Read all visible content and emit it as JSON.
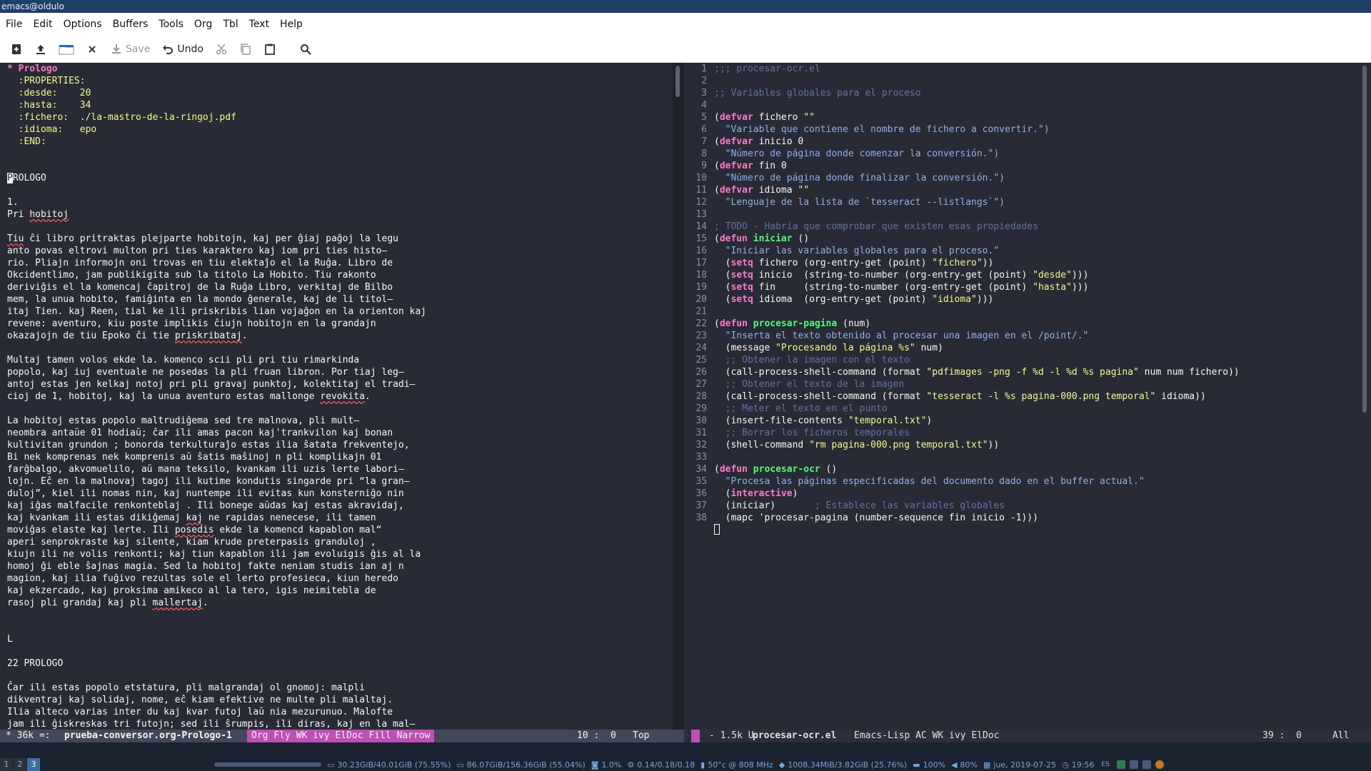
{
  "window": {
    "title": "emacs@oldulo"
  },
  "menubar": {
    "items": [
      "File",
      "Edit",
      "Options",
      "Buffers",
      "Tools",
      "Org",
      "Tbl",
      "Text",
      "Help"
    ]
  },
  "toolbar": {
    "save_label": "Save",
    "undo_label": "Undo",
    "icons": [
      "new-file-icon",
      "upload-icon",
      "open-folder-icon",
      "close-icon",
      "save-icon",
      "undo-icon",
      "cut-icon",
      "copy-icon",
      "paste-icon",
      "search-icon"
    ]
  },
  "left_buffer": {
    "lines": [
      "* Prologo",
      "  :PROPERTIES:",
      "  :desde:    20",
      "  :hasta:    34",
      "  :fichero:  ./la-mastro-de-la-ringoj.pdf",
      "  :idioma:   epo",
      "  :END:",
      "",
      "",
      "PROLOGO",
      "",
      "1.",
      "Pri hobitoj",
      "",
      "Tiu ĉi libro pritraktas plejparte hobitojn, kaj per ĝiaj paĝoj la legu",
      "anto povas eltrovi multon pri ties karaktero kaj iom pri ties histo—",
      "rio. Pliajn informojn oni trovas en tiu elektaĵo el la Ruĝa. Libro de",
      "Okcidentlimo, jam publikigita sub la titolo La Hobito. Tiu rakonto",
      "deriviĝis el la komencaj ĉapitroj de la Ruĝa Libro, verkitaj de Bilbo",
      "mem, la unua hobito, famiĝinta en la mondo ĝenerale, kaj de li titol—",
      "itaj Tien. kaj Reen, tial ke ili priskribis lian vojaĝon en la orienton kaj",
      "revene: aventuro, kiu poste implikis ĉiujn hobitojn en la grandajn",
      "okazajojn de tiu Epoko ĉi tie priskribataj.",
      "",
      "Multaj tamen volos ekde la. komenco scii pli pri tiu rimarkinda",
      "popolo, kaj iuj eventuale ne posedas la pli fruan libron. Por tiaj leg—",
      "antoj estas jen kelkaj notoj pri pli gravaj punktoj, kolektitaj el tradi—",
      "cioj de 1, hobitoj, kaj la unua aventuro estas mallonge revokita.",
      "",
      "La hobitoj estas popolo maltrudiĝema sed tre malnova, pli mult—",
      "neombra antaŭe 01 hodiaŭ; ĉar ili amas pacon kaj'trankvilon kaj bonan",
      "kultivitan grundon ; bonorda terkulturaĵo estas ilia ŝatata frekventejo,",
      "Bi nek komprenas nek komprenis aŭ ŝatis maŝinoj n pli komplikajn 01",
      "farĝbalgo, akvomuelilo, aŭ mana teksilo, kvankam ili uzis lerte labori—",
      "lojn. Eĉ en la malnovaj tagoj ili kutime kondutis singarde pri “la gran—",
      "duloj”, kiel ili nomas nin, kaj nuntempe ili evitas kun konsterniĝo nin",
      "kaj iĝas malfacile renkonteblaj . Ili bonege aŭdas kaj estas akravidaj,",
      "kaj kvankam ili estas dikiĝemaj kaj ne rapidas nenecese, ili tamen",
      "moviĝas elaste kaj lerte. Ili posedis ekde la komencd kapablon mal“",
      "aperi senprokraste kaj silente, kiam krude preterpasis granduloj ,",
      "kiujn ili ne volis renkonti; kaj tiun kapablon ili jam evoluigis ĝis al la",
      "homoj ĝi eble ŝajnas magia. Sed la hobitoj fakte neniam studis ian aj n",
      "magion, kaj ilia fuĝivo rezultas sole el lerto profesieca, kiun heredo",
      "kaj ekzercado, kaj proksima amikeco al la tero, igis neimitebla de",
      "rasoj pli grandaj kaj pli mallertaj.",
      "",
      "",
      "L",
      "",
      "22 PROLOGO",
      "",
      "Ĉar ili estas popolo etstatura, pli malgrandaj ol gnomoj: malpli",
      "dikventraj kaj solidaj, nome, eĉ kiam efektive ne multe pli malaltaj.",
      "Ilia alteco varias inter du kaj kvar futoj laŭ nia mezurunuo. Malofte",
      "jam ili ĝiskreskas tri futojn; sed ili ŝrumpis, ili diras, kaj en la mal—"
    ]
  },
  "right_buffer": {
    "lines": [
      ";;; procesar-ocr.el",
      "",
      ";; Variables globales para el proceso",
      "",
      "(defvar fichero \"\"",
      "  \"Variable que contiene el nombre de fichero a convertir.\")",
      "(defvar inicio 0",
      "  \"Número de página donde comenzar la conversión.\")",
      "(defvar fin 0",
      "  \"Número de página donde finalizar la conversión.\")",
      "(defvar idioma \"\"",
      "  \"Lenguaje de la lista de `tesseract --listlangs`\")",
      "",
      "; TODO - Habría que comprobar que existen esas propiedades",
      "(defun iniciar ()",
      "  \"Iniciar las variables globales para el proceso.\"",
      "  (setq fichero (org-entry-get (point) \"fichero\"))",
      "  (setq inicio  (string-to-number (org-entry-get (point) \"desde\")))",
      "  (setq fin     (string-to-number (org-entry-get (point) \"hasta\")))",
      "  (setq idioma  (org-entry-get (point) \"idioma\")))",
      "",
      "(defun procesar-pagina (num)",
      "  \"Inserta el texto obtenido al procesar una imagen en el /point/.\"",
      "  (message \"Procesando la página %s\" num)",
      "  ;; Obtener la imagen con el texto",
      "  (call-process-shell-command (format \"pdfimages -png -f %d -l %d %s pagina\" num num fichero))",
      "  ;; Obtener el texto de la imagen",
      "  (call-process-shell-command (format \"tesseract -l %s pagina-000.png temporal\" idioma))",
      "  ;; Meter el texto en el punto",
      "  (insert-file-contents \"temporal.txt\")",
      "  ;; Borrar los ficheros temporales",
      "  (shell-command \"rm pagina-000.png temporal.txt\"))",
      "",
      "(defun procesar-ocr ()",
      "  \"Procesa las páginas especificadas del documento dado en el buffer actual.\"",
      "  (interactive)",
      "  (iniciar)       ; Establece las variables globales",
      "  (mapc 'procesar-pagina (number-sequence fin inicio -1)))",
      ""
    ]
  },
  "modeline_left": {
    "state": "* 36k =:",
    "buffer": "prueba-conversor.org-Prologo-1",
    "modes": "Org Fly WK ivy ElDoc Fill Narrow",
    "position": "10 :  0",
    "scroll": "Top"
  },
  "modeline_right": {
    "state": "- 1.5k U:",
    "buffer": "procesar-ocr.el",
    "modes": "Emacs-Lisp AC WK ivy ElDoc",
    "position": "39 :  0",
    "scroll": "All"
  },
  "taskbar": {
    "workspaces": [
      "1",
      "2",
      "3"
    ],
    "active_workspace": "3",
    "status": [
      {
        "icon": "hdd-icon",
        "text": "30.23GiB/40.01GiB (75.55%)"
      },
      {
        "icon": "hdd-icon",
        "text": "86.07GiB/156.36GiB (55.04%)"
      },
      {
        "icon": "cpu-icon",
        "text": "1.0%"
      },
      {
        "icon": "load-icon",
        "text": "0.14/0.18/0.18"
      },
      {
        "icon": "temperature-icon",
        "text": "50°c @ 808 MHz"
      },
      {
        "icon": "memory-icon",
        "text": "1008.34MiB/3.82GiB (25.76%)"
      },
      {
        "icon": "battery-icon",
        "text": "100%"
      },
      {
        "icon": "volume-icon",
        "text": "80%"
      },
      {
        "icon": "calendar-icon",
        "text": "jue, 2019-07-25"
      },
      {
        "icon": "clock-icon",
        "text": "19:56"
      }
    ],
    "tray_label": "ES"
  },
  "colors": {
    "background": "#282a36",
    "foreground": "#f8f8f2",
    "keyword": "#ff79c6",
    "function": "#50fa7b",
    "string": "#f1fa8c",
    "docstring": "#8fb1e6",
    "comment": "#6272a4",
    "modeline_modes": "#bd4fb6"
  }
}
